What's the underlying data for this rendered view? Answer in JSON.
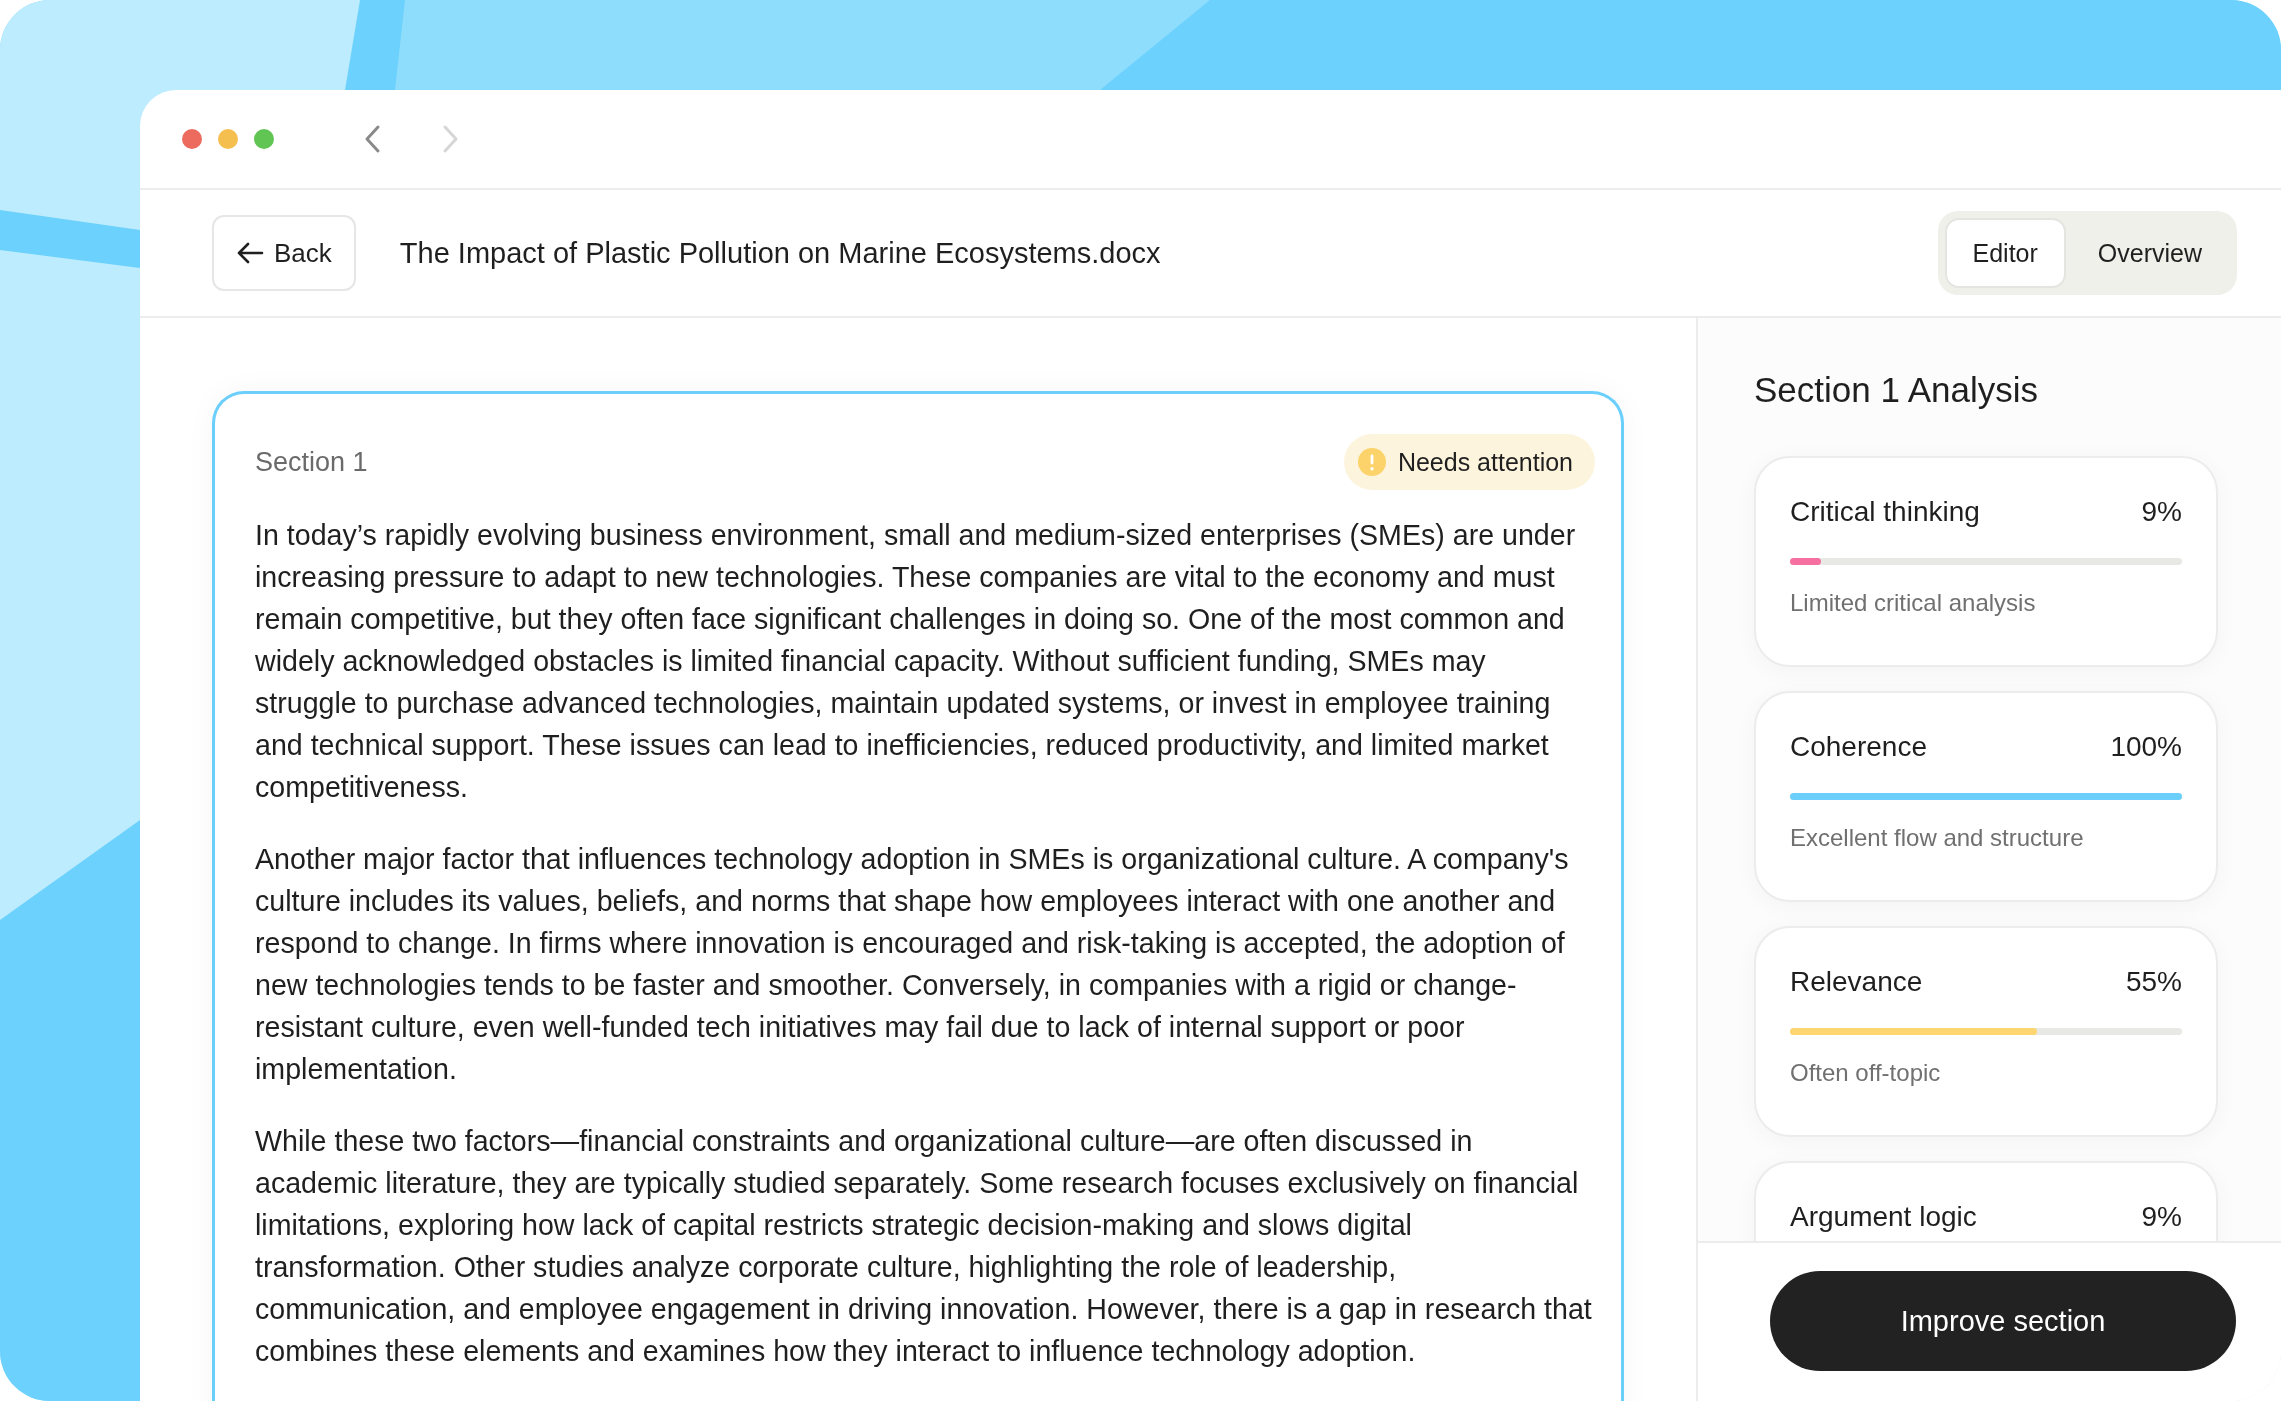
{
  "window": {
    "nav": [
      {
        "kind": "back",
        "disabled": false
      },
      {
        "kind": "forward",
        "disabled": true
      }
    ]
  },
  "header": {
    "back_button": "Back",
    "title": "The Impact of Plastic Pollution on Marine Ecosystems.docx",
    "tabs": [
      {
        "label": "Editor",
        "selected": true
      },
      {
        "label": "Overview",
        "selected": false
      }
    ]
  },
  "document": {
    "section_label": "Section 1",
    "badge": {
      "label": "Needs attention",
      "kind": "warning"
    },
    "paragraphs": [
      "In today’s rapidly evolving business environment, small and medium-sized enterprises (SMEs) are under increasing pressure to adapt to new technologies. These companies are vital to the economy and must remain competitive, but they often face significant challenges in doing so. One of the most common and widely acknowledged obstacles is limited financial capacity. Without sufficient funding, SMEs may struggle to purchase advanced technologies, maintain updated systems, or invest in employee training and technical support. These issues can lead to inefficiencies, reduced productivity, and limited market competitiveness.",
      "Another major factor that influences technology adoption in SMEs is organizational culture. A company's culture includes its values, beliefs, and norms that shape how employees interact with one another and respond to change. In firms where innovation is encouraged and risk-taking is accepted, the adoption of new technologies tends to be faster and smoother. Conversely, in companies with a rigid or change-resistant culture, even well-funded tech initiatives may fail due to lack of internal support or poor implementation.",
      "While these two factors—financial constraints and organizational culture—are often discussed in academic literature, they are typically studied separately. Some research focuses exclusively on financial limitations, exploring how lack of capital restricts strategic decision-making and slows digital transformation. Other studies analyze corporate culture, highlighting the role of leadership, communication, and employee engagement in driving innovation. However, there is a gap in research that combines these elements and examines how they interact to influence technology adoption."
    ]
  },
  "analysis": {
    "title": "Section 1 Analysis",
    "metrics": [
      {
        "name": "Critical thinking",
        "value": "9%",
        "level": 0.08,
        "color": "#f56fa1",
        "note": "Limited critical analysis"
      },
      {
        "name": "Coherence",
        "value": "100%",
        "level": 1.0,
        "color": "#6ccffb",
        "note": "Excellent flow and structure"
      },
      {
        "name": "Relevance",
        "value": "55%",
        "level": 0.63,
        "color": "#fdd671",
        "note": "Often off-topic"
      },
      {
        "name": "Argument logic",
        "value": "9%"
      }
    ],
    "action_button": "Improve section"
  }
}
